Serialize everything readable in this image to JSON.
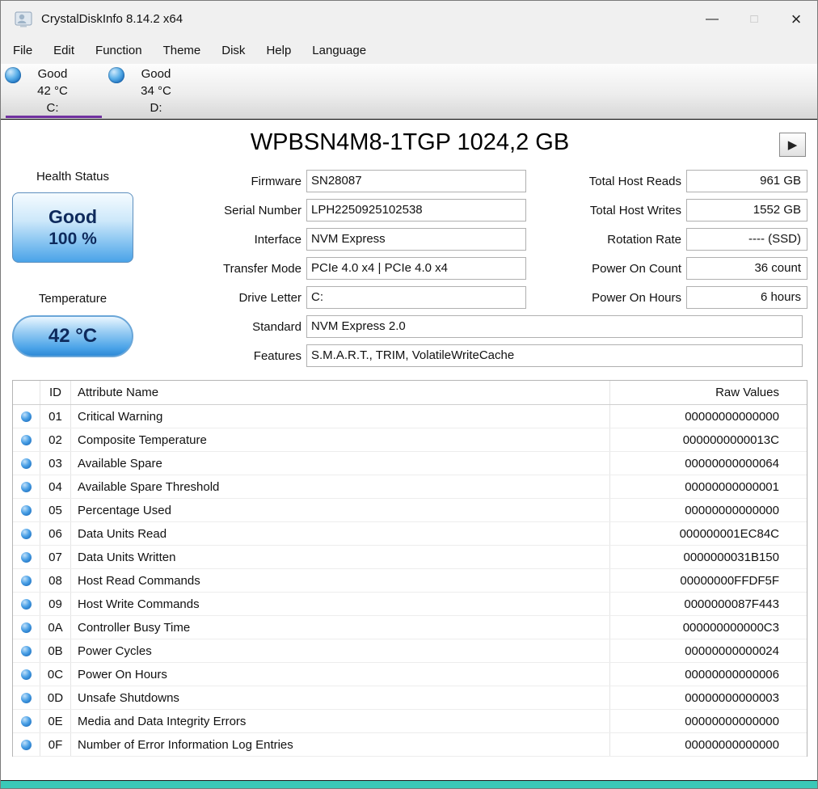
{
  "colors": {
    "accent_purple": "#7030a0",
    "footer_teal": "#3ac9b8",
    "health_text_blue": "#0e2a5c",
    "status_dot_blue": "#2a7fd4"
  },
  "window": {
    "title": "CrystalDiskInfo 8.14.2 x64",
    "controls": {
      "minimize": "—",
      "maximize": "□",
      "close": "×"
    }
  },
  "menu": [
    "File",
    "Edit",
    "Function",
    "Theme",
    "Disk",
    "Help",
    "Language"
  ],
  "drive_tabs": [
    {
      "status": "Good",
      "temperature": "42 °C",
      "letter": "C:"
    },
    {
      "status": "Good",
      "temperature": "34 °C",
      "letter": "D:"
    }
  ],
  "drive": {
    "title": "WPBSN4M8-1TGP 1024,2 GB",
    "play_icon": "▶",
    "health_label": "Health Status",
    "health_status": "Good",
    "health_percent": "100 %",
    "temperature_label": "Temperature",
    "temperature_value": "42 °C"
  },
  "info_fields": [
    {
      "label": "Firmware",
      "value": "SN28087"
    },
    {
      "label": "Serial Number",
      "value": "LPH2250925102538"
    },
    {
      "label": "Interface",
      "value": "NVM Express"
    },
    {
      "label": "Transfer Mode",
      "value": "PCIe 4.0 x4 | PCIe 4.0 x4"
    },
    {
      "label": "Drive Letter",
      "value": "C:"
    },
    {
      "label": "Standard",
      "value": "NVM Express 2.0"
    },
    {
      "label": "Features",
      "value": "S.M.A.R.T., TRIM, VolatileWriteCache"
    }
  ],
  "stats_fields": [
    {
      "label": "Total Host Reads",
      "value": "961 GB"
    },
    {
      "label": "Total Host Writes",
      "value": "1552 GB"
    },
    {
      "label": "Rotation Rate",
      "value": "---- (SSD)"
    },
    {
      "label": "Power On Count",
      "value": "36 count"
    },
    {
      "label": "Power On Hours",
      "value": "6 hours"
    }
  ],
  "smart": {
    "headers": {
      "id": "ID",
      "name": "Attribute Name",
      "raw": "Raw Values"
    },
    "rows": [
      {
        "id": "01",
        "name": "Critical Warning",
        "raw": "00000000000000"
      },
      {
        "id": "02",
        "name": "Composite Temperature",
        "raw": "0000000000013C"
      },
      {
        "id": "03",
        "name": "Available Spare",
        "raw": "00000000000064"
      },
      {
        "id": "04",
        "name": "Available Spare Threshold",
        "raw": "00000000000001"
      },
      {
        "id": "05",
        "name": "Percentage Used",
        "raw": "00000000000000"
      },
      {
        "id": "06",
        "name": "Data Units Read",
        "raw": "000000001EC84C"
      },
      {
        "id": "07",
        "name": "Data Units Written",
        "raw": "0000000031B150"
      },
      {
        "id": "08",
        "name": "Host Read Commands",
        "raw": "00000000FFDF5F"
      },
      {
        "id": "09",
        "name": "Host Write Commands",
        "raw": "0000000087F443"
      },
      {
        "id": "0A",
        "name": "Controller Busy Time",
        "raw": "000000000000C3"
      },
      {
        "id": "0B",
        "name": "Power Cycles",
        "raw": "00000000000024"
      },
      {
        "id": "0C",
        "name": "Power On Hours",
        "raw": "00000000000006"
      },
      {
        "id": "0D",
        "name": "Unsafe Shutdowns",
        "raw": "00000000000003"
      },
      {
        "id": "0E",
        "name": "Media and Data Integrity Errors",
        "raw": "00000000000000"
      },
      {
        "id": "0F",
        "name": "Number of Error Information Log Entries",
        "raw": "00000000000000"
      }
    ]
  }
}
